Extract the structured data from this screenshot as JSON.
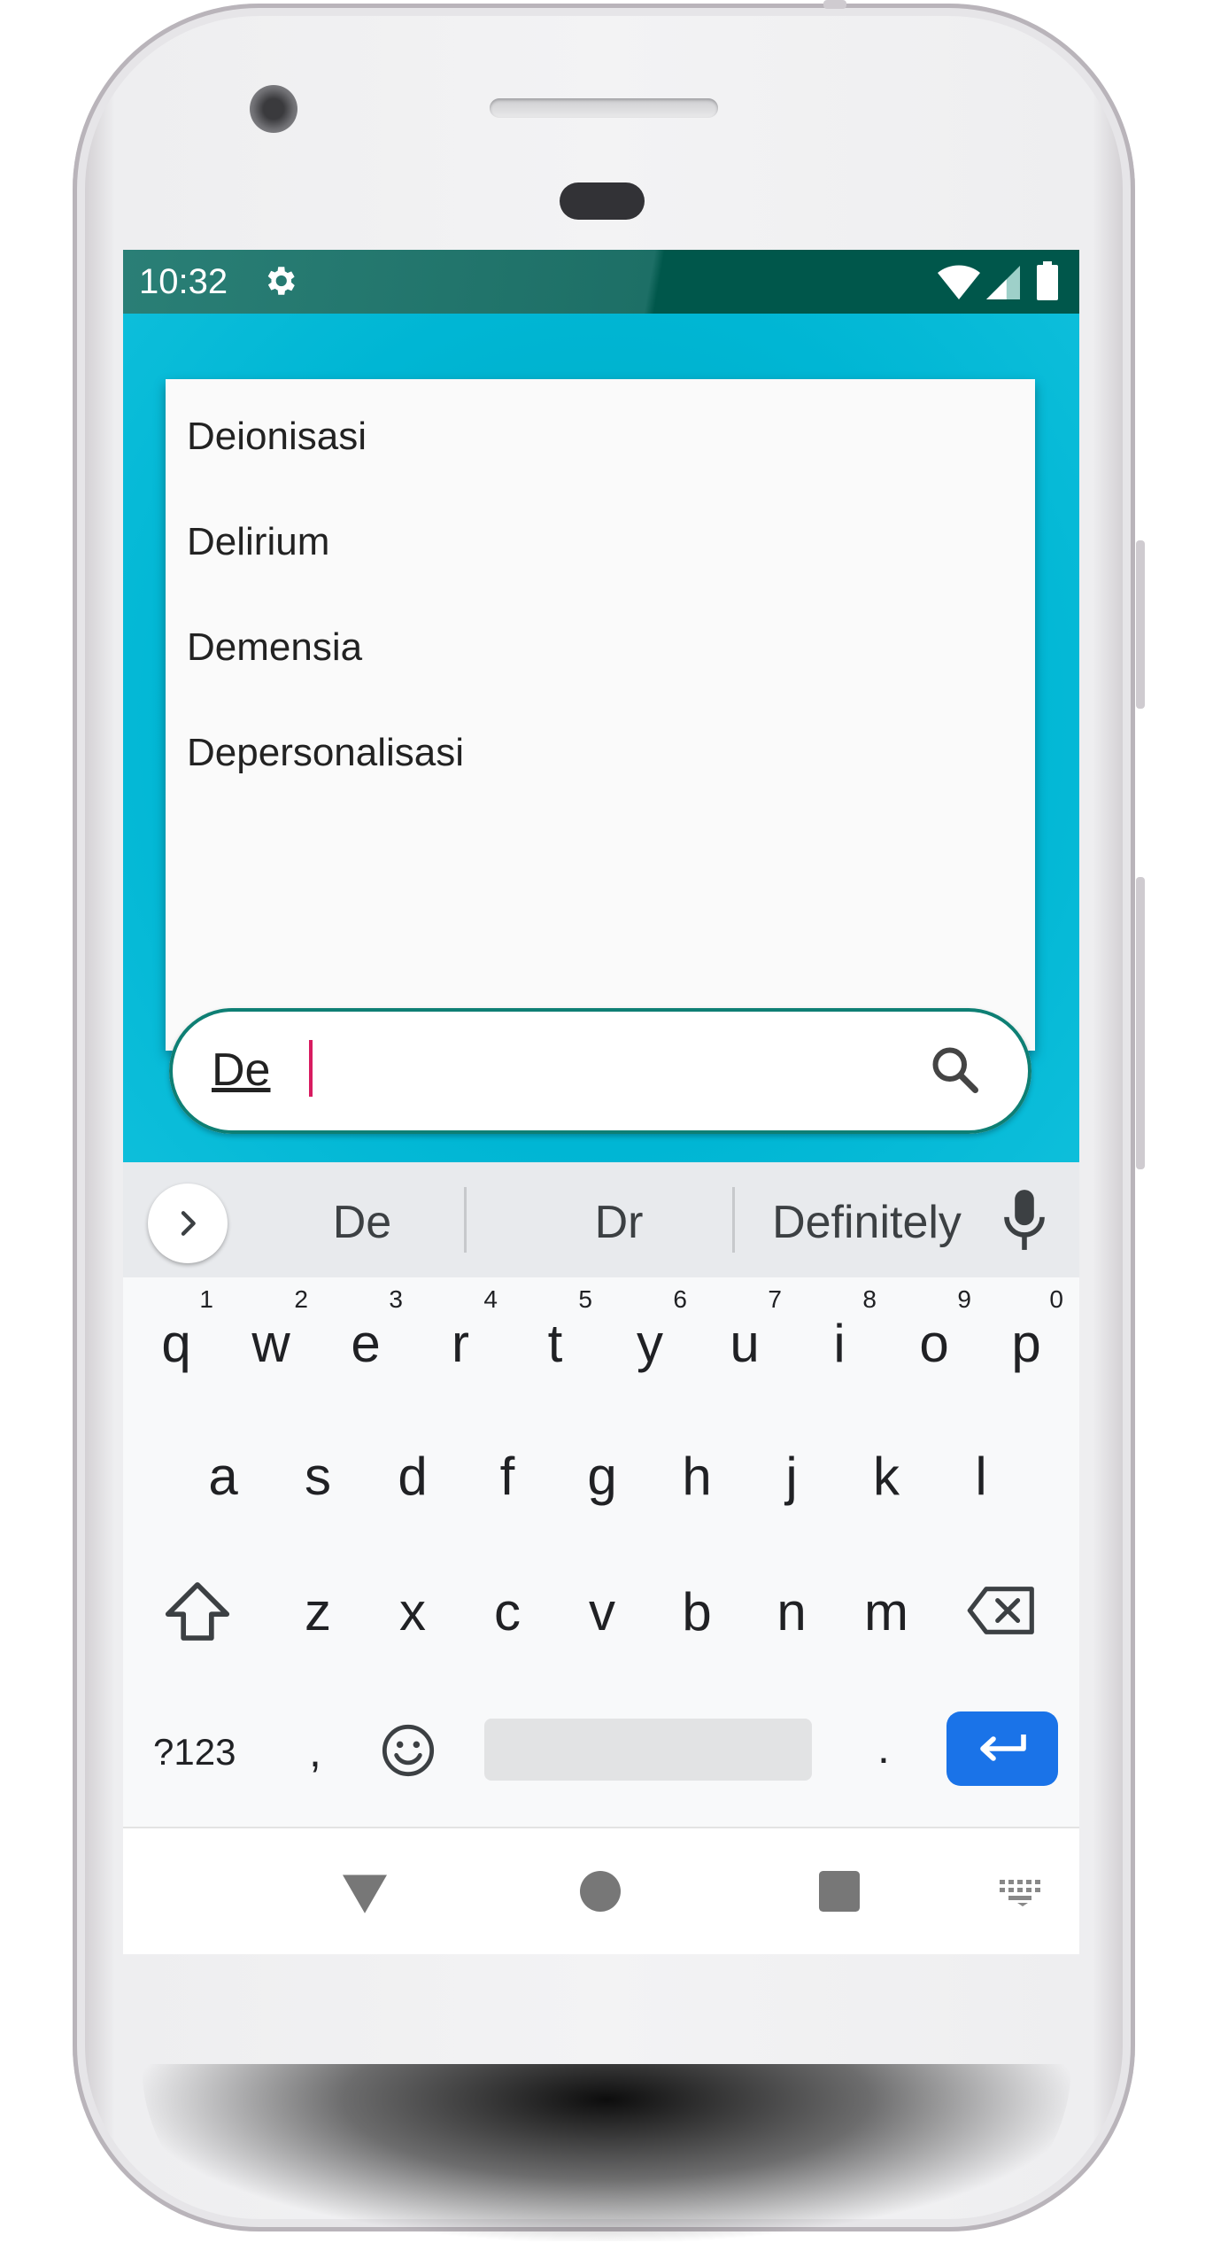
{
  "status_bar": {
    "time": "10:32"
  },
  "dropdown": {
    "items": [
      "Deionisasi",
      "Delirium",
      "Demensia",
      "Depersonalisasi"
    ]
  },
  "search": {
    "value": "De"
  },
  "keyboard": {
    "suggestions": [
      "De",
      "Dr",
      "Definitely"
    ],
    "row1": [
      {
        "key": "q",
        "hint": "1"
      },
      {
        "key": "w",
        "hint": "2"
      },
      {
        "key": "e",
        "hint": "3"
      },
      {
        "key": "r",
        "hint": "4"
      },
      {
        "key": "t",
        "hint": "5"
      },
      {
        "key": "y",
        "hint": "6"
      },
      {
        "key": "u",
        "hint": "7"
      },
      {
        "key": "i",
        "hint": "8"
      },
      {
        "key": "o",
        "hint": "9"
      },
      {
        "key": "p",
        "hint": "0"
      }
    ],
    "row2": [
      "a",
      "s",
      "d",
      "f",
      "g",
      "h",
      "j",
      "k",
      "l"
    ],
    "row3": [
      "z",
      "x",
      "c",
      "v",
      "b",
      "n",
      "m"
    ],
    "symbols_key": "?123",
    "comma": ",",
    "period": "."
  },
  "colors": {
    "status_bar": "#00574b",
    "app_background": "#00b4d2",
    "search_border": "#0e7f74",
    "caret": "#d81b60",
    "enter_key": "#1a73e8"
  },
  "icons": [
    "gear-icon",
    "wifi-icon",
    "cellular-icon",
    "battery-icon",
    "search-icon",
    "chevron-right-icon",
    "mic-icon",
    "shift-icon",
    "backspace-icon",
    "emoji-icon",
    "enter-icon",
    "back-icon",
    "home-icon",
    "recents-icon",
    "keyboard-switch-icon"
  ]
}
